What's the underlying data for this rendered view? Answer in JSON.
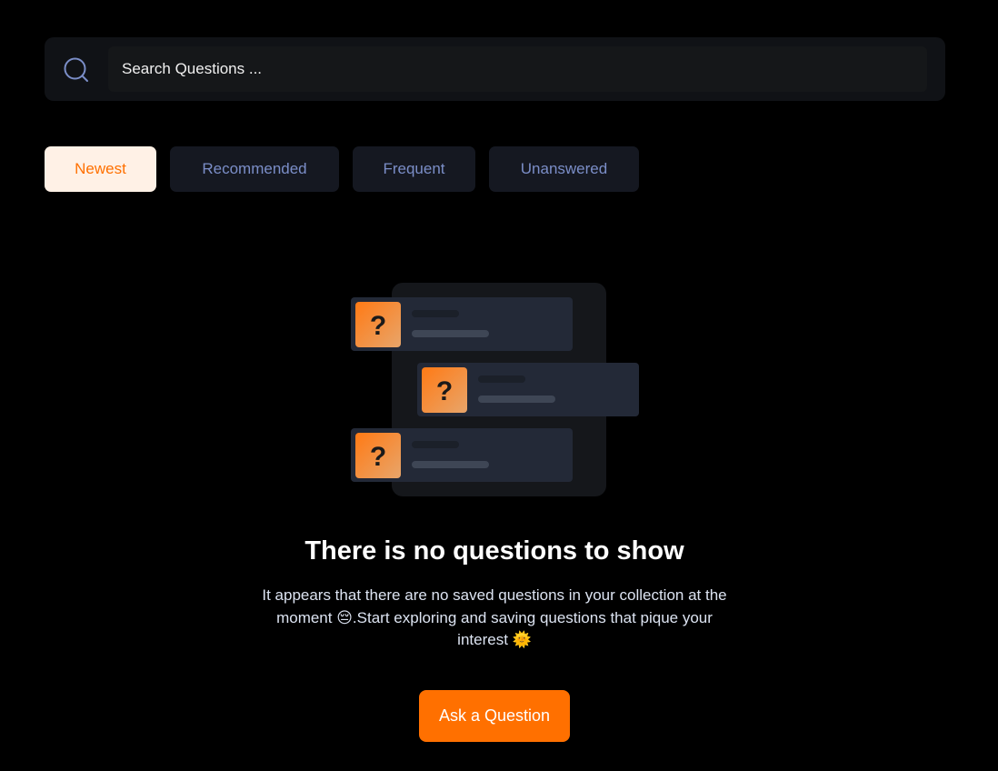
{
  "search": {
    "placeholder": "Search Questions ...",
    "icon": "search-icon"
  },
  "filters": [
    {
      "label": "Newest",
      "active": true
    },
    {
      "label": "Recommended",
      "active": false
    },
    {
      "label": "Frequent",
      "active": false
    },
    {
      "label": "Unanswered",
      "active": false
    }
  ],
  "empty_state": {
    "illustration_glyph": "?",
    "title": "There is no questions to show",
    "description": "It appears that there are no saved questions in your collection at the moment 😔.Start exploring and saving questions that pique your interest 🌞",
    "cta_label": "Ask a Question"
  },
  "colors": {
    "accent": "#ff7000",
    "background": "#000000",
    "card": "#151821",
    "filter_text": "#7b8ec8"
  }
}
